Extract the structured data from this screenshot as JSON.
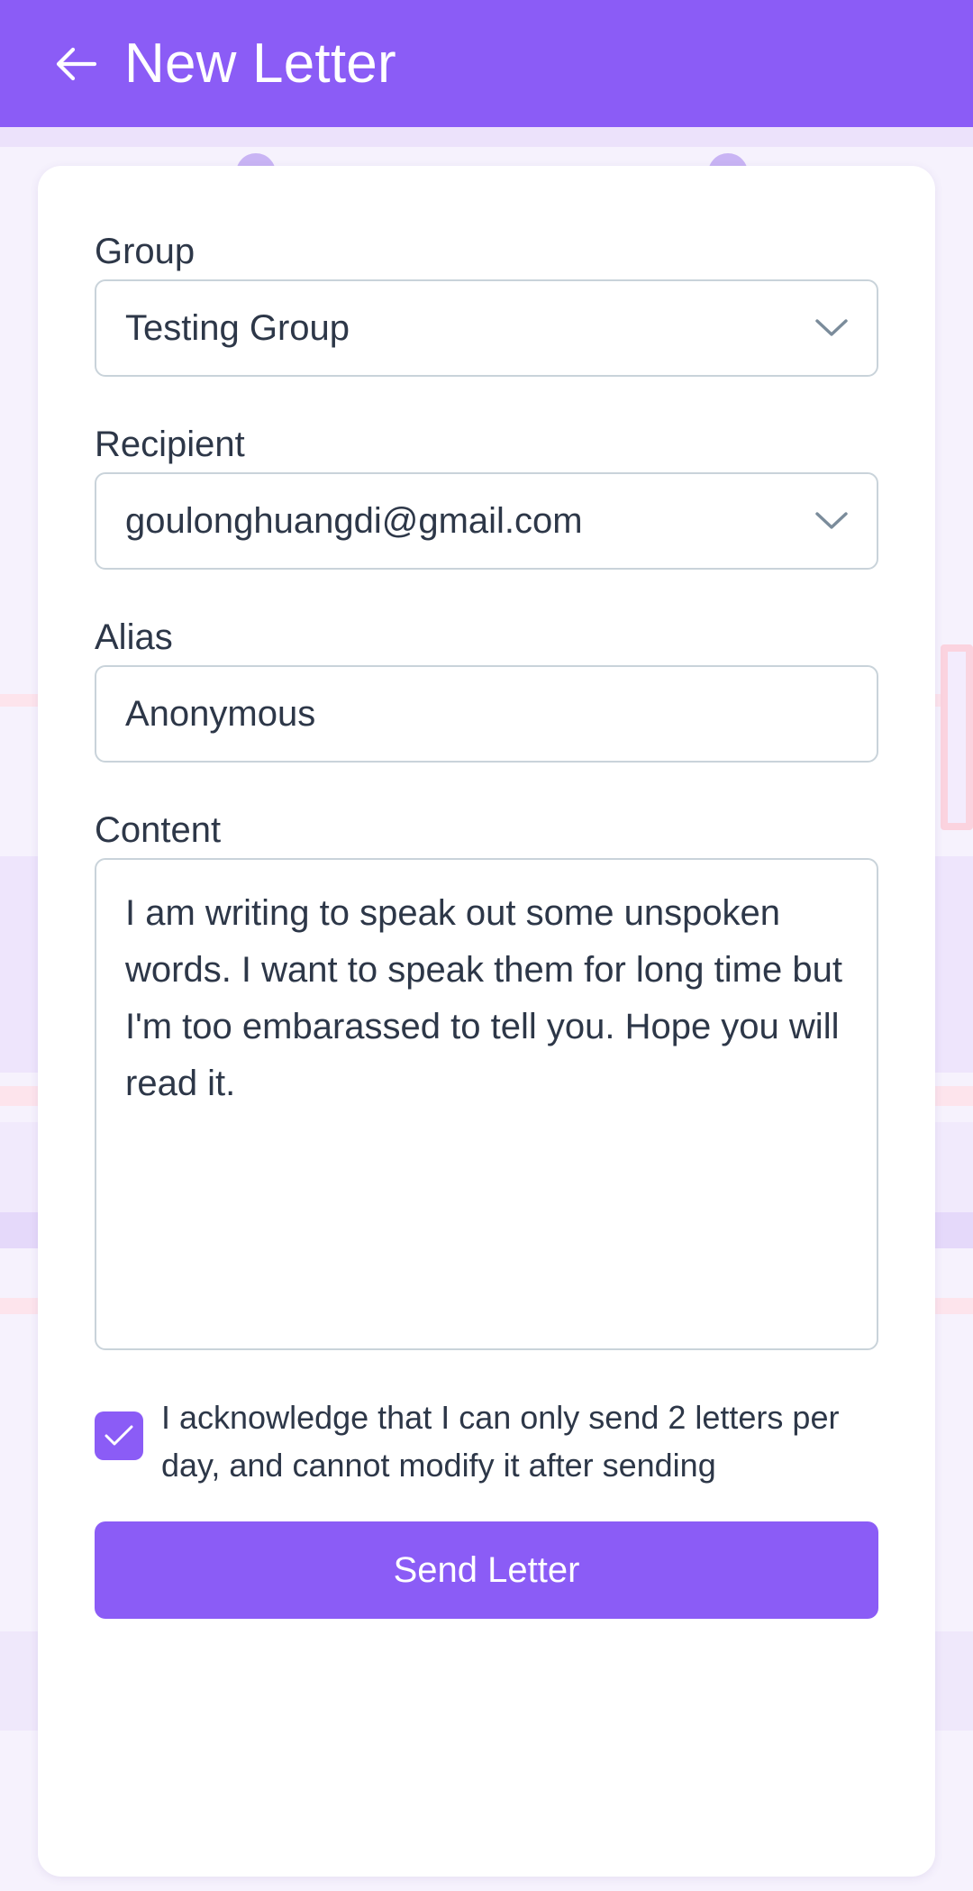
{
  "header": {
    "title": "New Letter",
    "back_icon": "arrow-left-icon"
  },
  "form": {
    "group": {
      "label": "Group",
      "value": "Testing Group"
    },
    "recipient": {
      "label": "Recipient",
      "value": "goulonghuangdi@gmail.com"
    },
    "alias": {
      "label": "Alias",
      "value": "Anonymous"
    },
    "content": {
      "label": "Content",
      "value": "I am writing to speak out some unspoken words. I want to speak them for long time but I'm too embarassed to tell you. Hope you will read it."
    },
    "acknowledge": {
      "checked": true,
      "text": "I acknowledge that I can only send 2 letters per day, and cannot modify it after sending"
    },
    "submit_label": "Send Letter"
  },
  "colors": {
    "accent": "#8b5cf6",
    "border": "#c9d3da",
    "text": "#2d3748"
  }
}
